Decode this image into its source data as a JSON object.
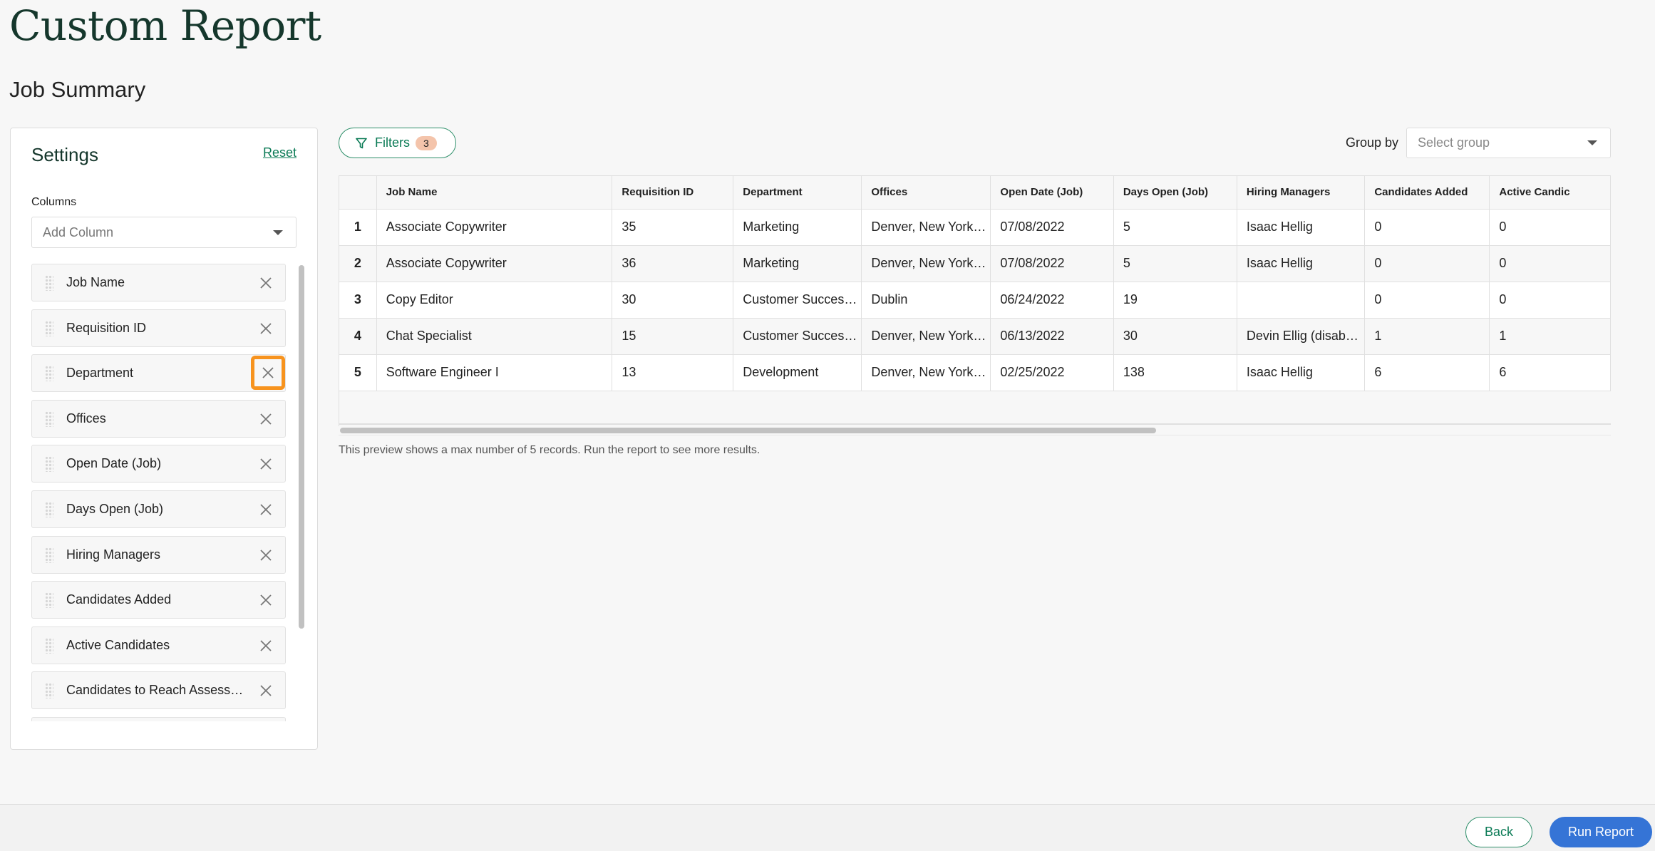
{
  "page": {
    "title": "Custom Report",
    "subtitle": "Job Summary"
  },
  "settings": {
    "title": "Settings",
    "reset_label": "Reset",
    "columns_label": "Columns",
    "add_column_placeholder": "Add Column",
    "columns": [
      {
        "label": "Job Name",
        "remove_icon": "close-icon"
      },
      {
        "label": "Requisition ID",
        "remove_icon": "close-icon"
      },
      {
        "label": "Department",
        "remove_icon": "close-icon",
        "highlighted": true
      },
      {
        "label": "Offices",
        "remove_icon": "close-icon"
      },
      {
        "label": "Open Date (Job)",
        "remove_icon": "close-icon"
      },
      {
        "label": "Days Open (Job)",
        "remove_icon": "close-icon"
      },
      {
        "label": "Hiring Managers",
        "remove_icon": "close-icon"
      },
      {
        "label": "Candidates Added",
        "remove_icon": "close-icon"
      },
      {
        "label": "Active Candidates",
        "remove_icon": "close-icon"
      },
      {
        "label": "Candidates to Reach Assess…",
        "remove_icon": "close-icon"
      },
      {
        "label": "",
        "remove_icon": "close-icon"
      }
    ]
  },
  "toolbar": {
    "filters_label": "Filters",
    "filters_icon": "filter-icon",
    "filters_count": "3",
    "group_by_label": "Group by",
    "group_by_placeholder": "Select group"
  },
  "table": {
    "headers": [
      "",
      "Job Name",
      "Requisition ID",
      "Department",
      "Offices",
      "Open Date (Job)",
      "Days Open (Job)",
      "Hiring Managers",
      "Candidates Added",
      "Active Candic"
    ],
    "rows": [
      [
        "1",
        "Associate Copywriter",
        "35",
        "Marketing",
        "Denver, New York…",
        "07/08/2022",
        "5",
        "Isaac Hellig",
        "0",
        "0"
      ],
      [
        "2",
        "Associate Copywriter",
        "36",
        "Marketing",
        "Denver, New York…",
        "07/08/2022",
        "5",
        "Isaac Hellig",
        "0",
        "0"
      ],
      [
        "3",
        "Copy Editor",
        "30",
        "Customer Succes…",
        "Dublin",
        "06/24/2022",
        "19",
        "",
        "0",
        "0"
      ],
      [
        "4",
        "Chat Specialist",
        "15",
        "Customer Succes…",
        "Denver, New York…",
        "06/13/2022",
        "30",
        "Devin Ellig (disab…",
        "1",
        "1"
      ],
      [
        "5",
        "Software Engineer I",
        "13",
        "Development",
        "Denver, New York…",
        "02/25/2022",
        "138",
        "Isaac Hellig",
        "6",
        "6"
      ]
    ]
  },
  "preview_note": "This preview shows a max number of 5 records. Run the report to see more results.",
  "footer": {
    "back_label": "Back",
    "run_label": "Run Report"
  },
  "colors": {
    "brand_green": "#0a7a55",
    "title_green": "#15372c",
    "primary_blue": "#3574d6",
    "badge_peach": "#f4c4ab",
    "highlight_orange": "#f7931e"
  }
}
